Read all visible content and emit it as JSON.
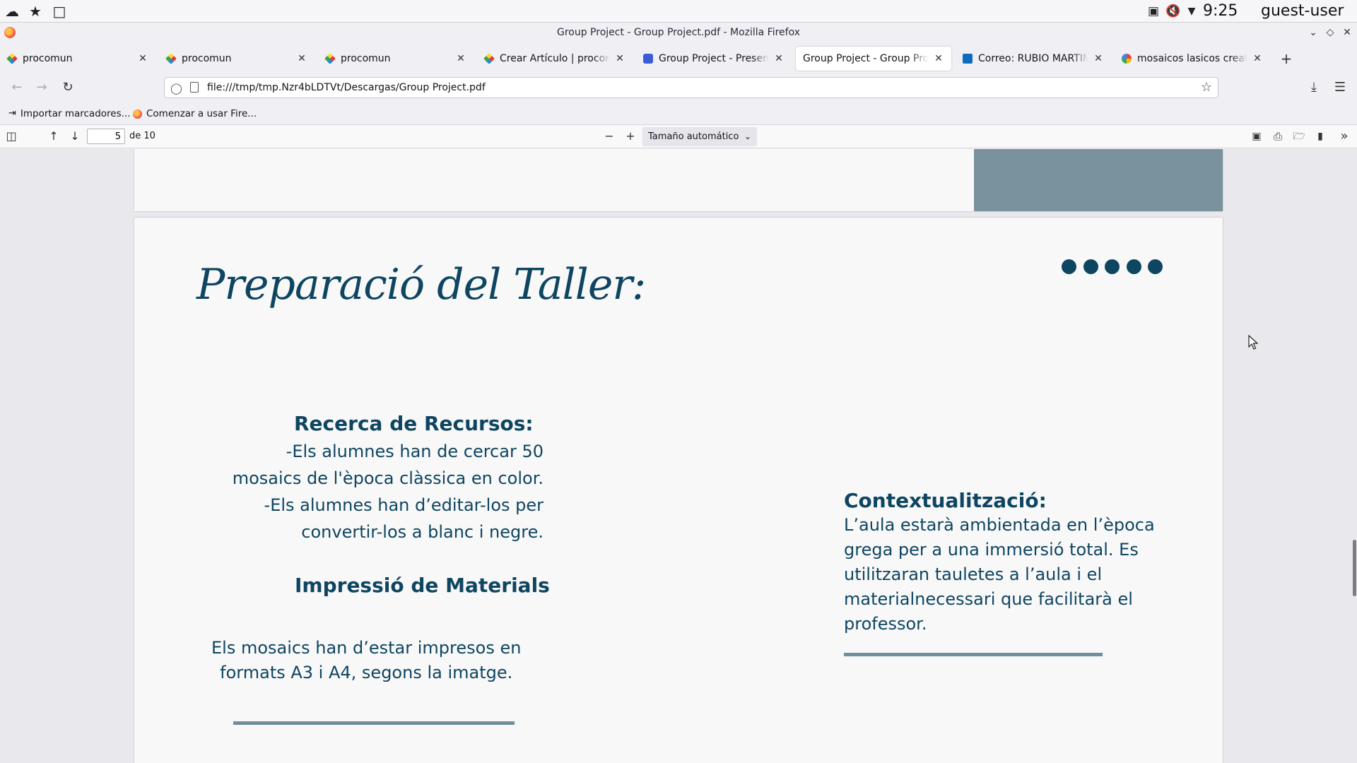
{
  "system_panel": {
    "clock": "9:25",
    "user": "guest-user"
  },
  "window": {
    "title": "Group Project - Group Project.pdf - Mozilla Firefox"
  },
  "tabs": [
    {
      "label": "procomun",
      "icon": "procomun-icon",
      "active": false
    },
    {
      "label": "procomun",
      "icon": "procomun-icon",
      "active": false
    },
    {
      "label": "procomun",
      "icon": "procomun-icon",
      "active": false
    },
    {
      "label": "Crear Artículo | procomun",
      "icon": "procomun-icon",
      "active": false
    },
    {
      "label": "Group Project - Presentatio",
      "icon": "presentation-app-icon",
      "active": false
    },
    {
      "label": "Group Project - Group Project",
      "icon": "pdf-icon",
      "active": true
    },
    {
      "label": "Correo: RUBIO MARTINEZ,",
      "icon": "outlook-mail-icon",
      "active": false
    },
    {
      "label": "mosaicos lasicos creative c",
      "icon": "google-icon",
      "active": false
    }
  ],
  "address_bar": {
    "url": "file:///tmp/tmp.Nzr4bLDTVt/Descargas/Group Project.pdf"
  },
  "bookmarks": [
    {
      "label": "Importar marcadores...",
      "icon": "import-icon"
    },
    {
      "label": "Comenzar a usar Fire...",
      "icon": "firefox-icon"
    }
  ],
  "pdf_toolbar": {
    "page_number": "5",
    "page_count_label": "de 10",
    "zoom_label": "Tamaño automático"
  },
  "slide": {
    "title": "Preparació del Taller:",
    "dots_count": 5,
    "recerca": {
      "heading": "Recerca de Recursos:",
      "lines": [
        "-Els alumnes han de cercar 50",
        "mosaics de l'època clàssica en color.",
        "-Els alumnes han d’editar-los per",
        "convertir-los a blanc i negre."
      ]
    },
    "impressio": {
      "heading": "Impressió de Materials",
      "lines": [
        "Els mosaics han d’estar impresos en",
        "formats A3 i A4, segons la imatge."
      ]
    },
    "contextualitzacio": {
      "heading": "Contextualització:",
      "lines": [
        "L’aula estarà ambientada en l’època",
        "grega per a una immersió total. Es",
        "utilitzaran tauletes a l’aula i el",
        "materialnecessari que facilitarà el",
        "professor."
      ]
    }
  },
  "colors": {
    "slide_text": "#0e4561",
    "slide_rule": "#728d9c",
    "slide_block": "#7a919e",
    "slide_bg": "#f8f8f8"
  }
}
